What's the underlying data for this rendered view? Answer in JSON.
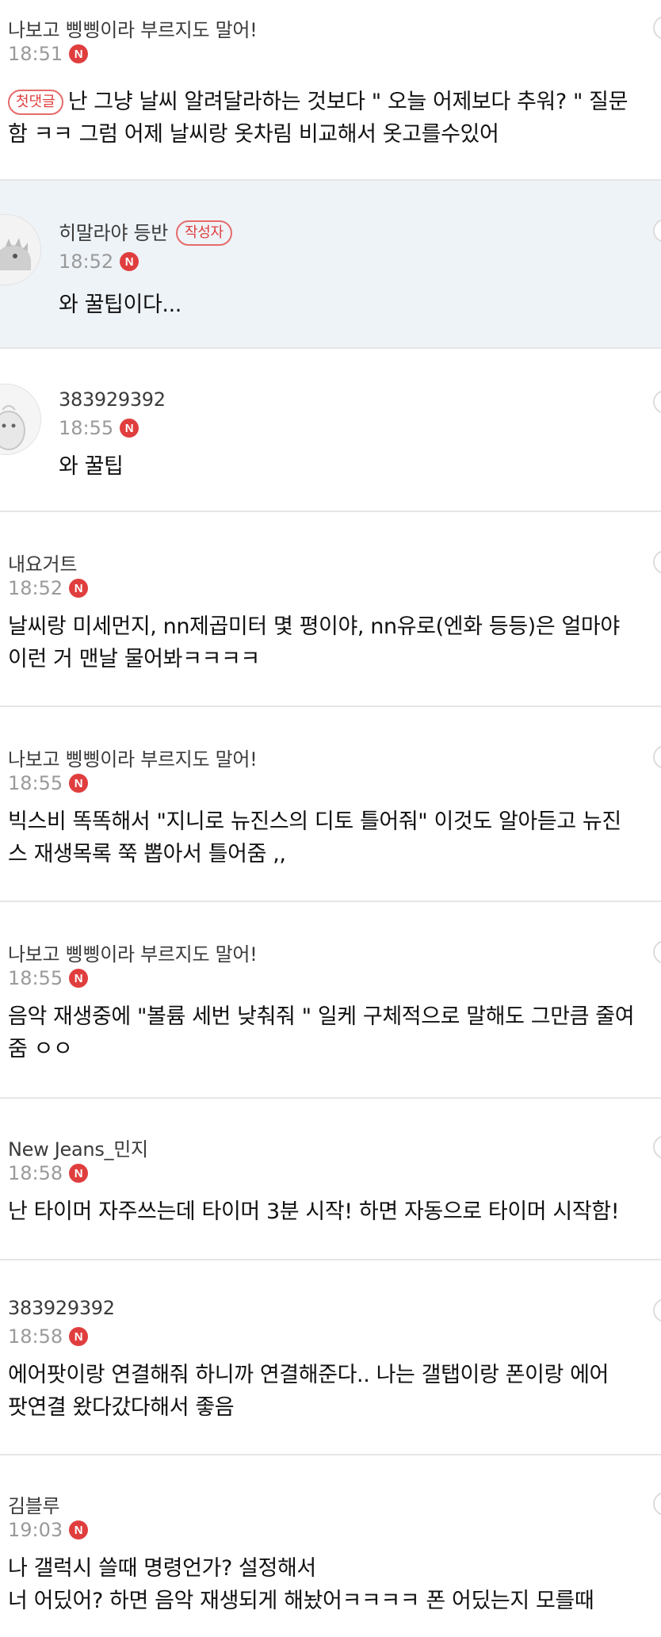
{
  "comments": [
    {
      "author": "나보고 삥삥이라 부르지도 말어!",
      "time": "18:51",
      "badge": "N",
      "tag": "첫댓글",
      "lines": [
        "난 그냥 날씨 알려달라하는 것보다 \" 오늘 어제보다 추워? \" 질문",
        "함 ㅋㅋ 그럼 어제 날씨랑 옷차림 비교해서 옷고를수있어"
      ]
    },
    {
      "author": "히말라야 등반",
      "author_tag": "작성자",
      "time": "18:52",
      "badge": "N",
      "lines": [
        "와 꿀팁이다..."
      ]
    },
    {
      "author": "383929392",
      "time": "18:55",
      "badge": "N",
      "lines": [
        "와 꿀팁"
      ]
    },
    {
      "author": "내요거트",
      "time": "18:52",
      "badge": "N",
      "lines": [
        "날씨랑 미세먼지, nn제곱미터 몇 평이야, nn유로(엔화 등등)은 얼마야",
        "이런 거 맨날 물어봐ㅋㅋㅋㅋ"
      ]
    },
    {
      "author": "나보고 삥삥이라 부르지도 말어!",
      "time": "18:55",
      "badge": "N",
      "lines": [
        "빅스비 똑똑해서 \"지니로 뉴진스의 디토 틀어줘\" 이것도 알아듣고 뉴진",
        "스 재생목록 쭉 뽑아서 틀어줌 ,,"
      ]
    },
    {
      "author": "나보고 삥삥이라 부르지도 말어!",
      "time": "18:55",
      "badge": "N",
      "lines": [
        "음악 재생중에 \"볼륨 세번 낮춰줘 \" 일케 구체적으로 말해도 그만큼 줄여",
        "줌 ㅇㅇ"
      ]
    },
    {
      "author": "New Jeans_민지",
      "time": "18:58",
      "badge": "N",
      "lines": [
        "난 타이머 자주쓰는데 타이머 3분 시작! 하면 자동으로 타이머 시작함!"
      ]
    },
    {
      "author": "383929392",
      "time": "18:58",
      "badge": "N",
      "lines": [
        "에어팟이랑 연결해줘 하니까 연결해준다.. 나는 갤탭이랑 폰이랑 에어",
        "팟연결 왔다갔다해서 좋음"
      ]
    },
    {
      "author": "김블루",
      "time": "19:03",
      "badge": "N",
      "lines": [
        "나 갤럭시 쓸때 명령언가? 설정해서",
        "너 어딨어? 하면 음악 재생되게 해놨어ㅋㅋㅋㅋ 폰 어딨는지 모를때"
      ]
    }
  ],
  "colors": {
    "badge": "#e03e3e",
    "highlight_bg": "#eef3f8",
    "divider": "#e6e6e6"
  },
  "icons": [
    "new-badge-icon",
    "more-options-icon",
    "avatar-dinosaur-icon",
    "avatar-character-icon"
  ]
}
